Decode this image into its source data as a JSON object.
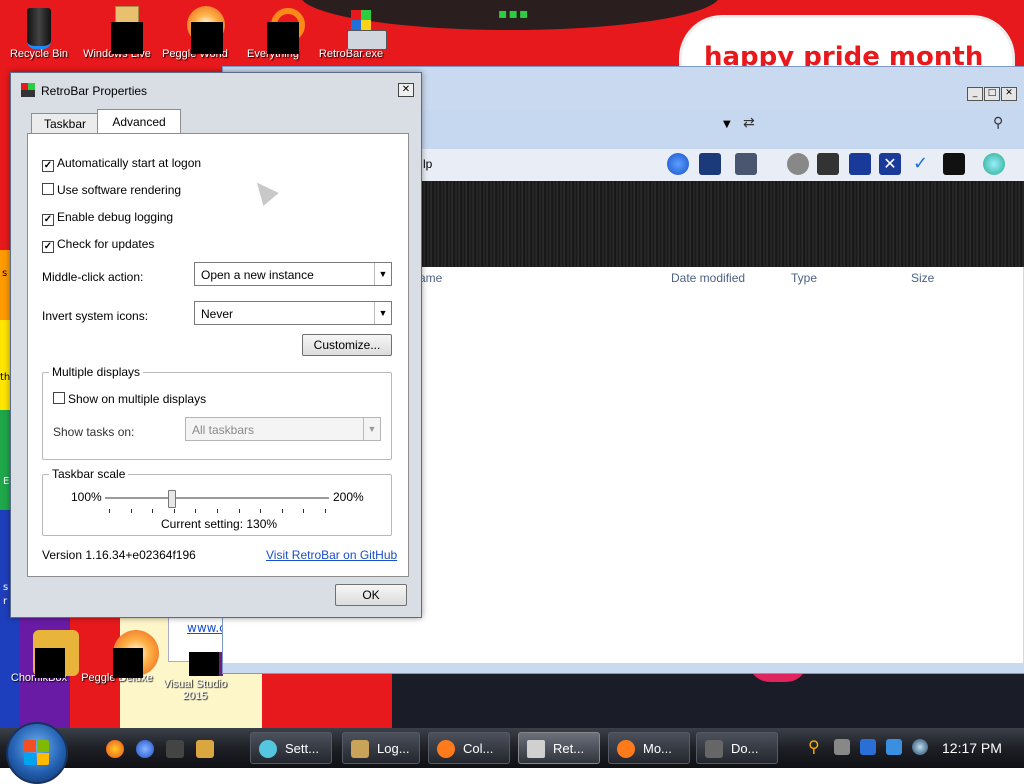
{
  "desktop": {
    "speech_text": "happy pride month",
    "web_snippet": "www.c",
    "icons_top": [
      {
        "label": "Recycle Bin"
      },
      {
        "label": "Windows Live"
      },
      {
        "label": "Peggle World"
      },
      {
        "label": "Everything"
      },
      {
        "label": "RetroBar.exe"
      }
    ],
    "icons_bottom": [
      {
        "label": "ChomikBox"
      },
      {
        "label": "Peggle Deluxe"
      },
      {
        "label": "Visual Studio 2015"
      }
    ],
    "left_edge_letters": [
      "s",
      "th",
      "E",
      "s",
      "r"
    ]
  },
  "explorer": {
    "toolbar_partial_label": "lp",
    "columns": [
      "ame",
      "Date modified",
      "Type",
      "Size"
    ],
    "title_buttons": [
      "_",
      "□",
      "✕"
    ]
  },
  "dialog": {
    "title": "RetroBar Properties",
    "close_glyph": "✕",
    "tabs": [
      {
        "label": "Taskbar"
      },
      {
        "label": "Advanced",
        "selected": true
      }
    ],
    "options": [
      {
        "label": "Automatically start at logon",
        "checked": true
      },
      {
        "label": "Use software rendering",
        "checked": false
      },
      {
        "label": "Enable debug logging",
        "checked": true
      },
      {
        "label": "Check for updates",
        "checked": true
      }
    ],
    "middle_click": {
      "label": "Middle-click action:",
      "value": "Open a new instance"
    },
    "invert_icons": {
      "label": "Invert system icons:",
      "value": "Never"
    },
    "customize_button": "Customize...",
    "multiple_displays": {
      "title": "Multiple displays",
      "show_label": "Show on multiple displays",
      "show_checked": false,
      "tasks_label": "Show tasks on:",
      "tasks_value": "All taskbars"
    },
    "scale": {
      "title": "Taskbar scale",
      "min_label": "100%",
      "max_label": "200%",
      "current": "Current setting: 130%",
      "value_fraction": 0.3
    },
    "version": "Version 1.16.34+e02364f196",
    "github_link": "Visit RetroBar on GitHub",
    "ok_button": "OK"
  },
  "taskbar": {
    "items": [
      {
        "label": "Sett...",
        "icon_color": "#55c6e0"
      },
      {
        "label": "Log...",
        "icon_color": "#c9a35a"
      },
      {
        "label": "Col...",
        "icon_color": "#ff7a1a"
      },
      {
        "label": "Ret...",
        "icon_color": "#d0d0d0",
        "active": true
      },
      {
        "label": "Mo...",
        "icon_color": "#ff7a1a"
      },
      {
        "label": "Do...",
        "icon_color": "#666666"
      }
    ],
    "clock": "12:17 PM"
  }
}
